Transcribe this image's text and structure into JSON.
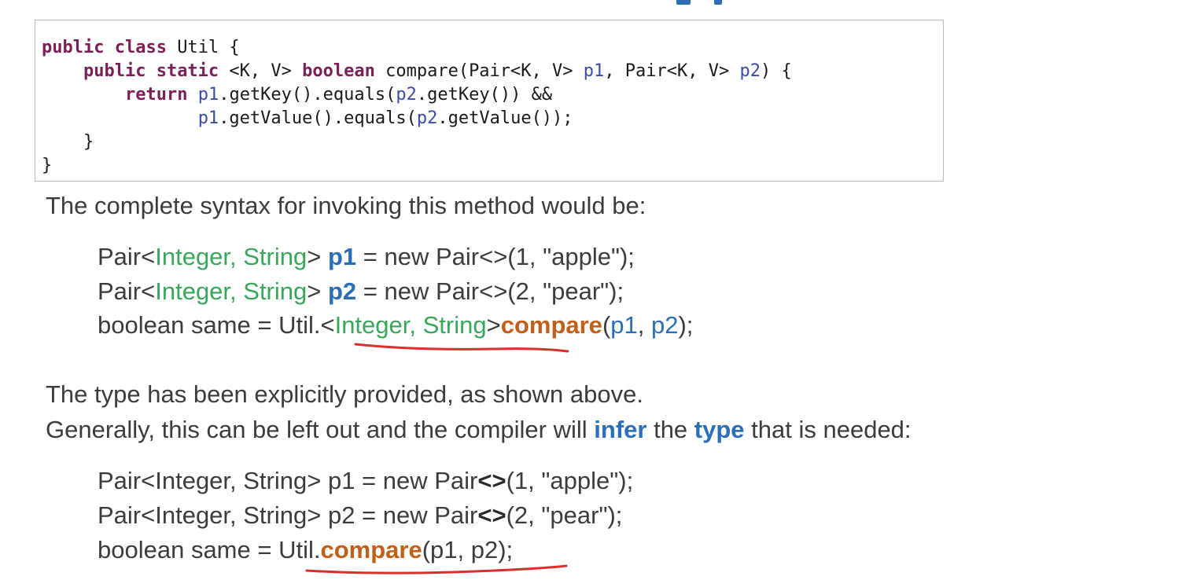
{
  "code": {
    "line1": {
      "kw": "public class",
      "rest": " Util {"
    },
    "line2": {
      "indent": "    ",
      "kw1": "public static",
      "mid1": " <K, V> ",
      "kw2": "boolean",
      "mid2": " compare(Pair<K, V> ",
      "p1": "p1",
      "mid3": ", Pair<K, V> ",
      "p2": "p2",
      "end": ") {"
    },
    "line3": {
      "indent": "        ",
      "kw": "return",
      "sp": " ",
      "p1": "p1",
      "mid": ".getKey().equals(",
      "p2": "p2",
      "end": ".getKey()) &&"
    },
    "line4": {
      "indent": "               ",
      "p1": "p1",
      "mid": ".getValue().equals(",
      "p2": "p2",
      "end": ".getValue());"
    },
    "line5": "    }",
    "line6": "}"
  },
  "intro_text": "The complete syntax for invoking this method would be:",
  "explicit": {
    "line1": {
      "a": "Pair<",
      "b": "Integer, String",
      "c": "> ",
      "d": "p1",
      "e": " = new Pair<>(1, \"apple\");"
    },
    "line2": {
      "a": "Pair<",
      "b": "Integer, String",
      "c": "> ",
      "d": "p2",
      "e": " = new Pair<>(2, \"pear\");"
    },
    "line3": {
      "a": "boolean  same = Util.<",
      "b": "Integer, String",
      "c": ">",
      "d": "compare",
      "e": "(",
      "f": "p1",
      "g": ", ",
      "h": "p2",
      "i": ");"
    }
  },
  "para": {
    "line1": "The type has been explicitly provided, as shown above.",
    "line2": {
      "a": "Generally, this can be left out and the compiler will ",
      "b": "infer",
      "c": " the ",
      "d": "type",
      "e": " that is needed:"
    }
  },
  "inferred": {
    "line1": {
      "a": "Pair<Integer, String> p1 = new Pair",
      "b": "<>",
      "c": "(1, \"apple\");"
    },
    "line2": {
      "a": "Pair<Integer, String> p2 = new Pair",
      "b": "<>",
      "c": "(2, \"pear\");"
    },
    "line3": {
      "a": "boolean   same = Util.",
      "b": "compare",
      "c": "(p1, p2);"
    }
  },
  "colors": {
    "green": "#3aa65a",
    "blue": "#2a6fb8",
    "orange": "#c0601a",
    "red_underline": "#d9302c",
    "keyword": "#7b1f58"
  }
}
